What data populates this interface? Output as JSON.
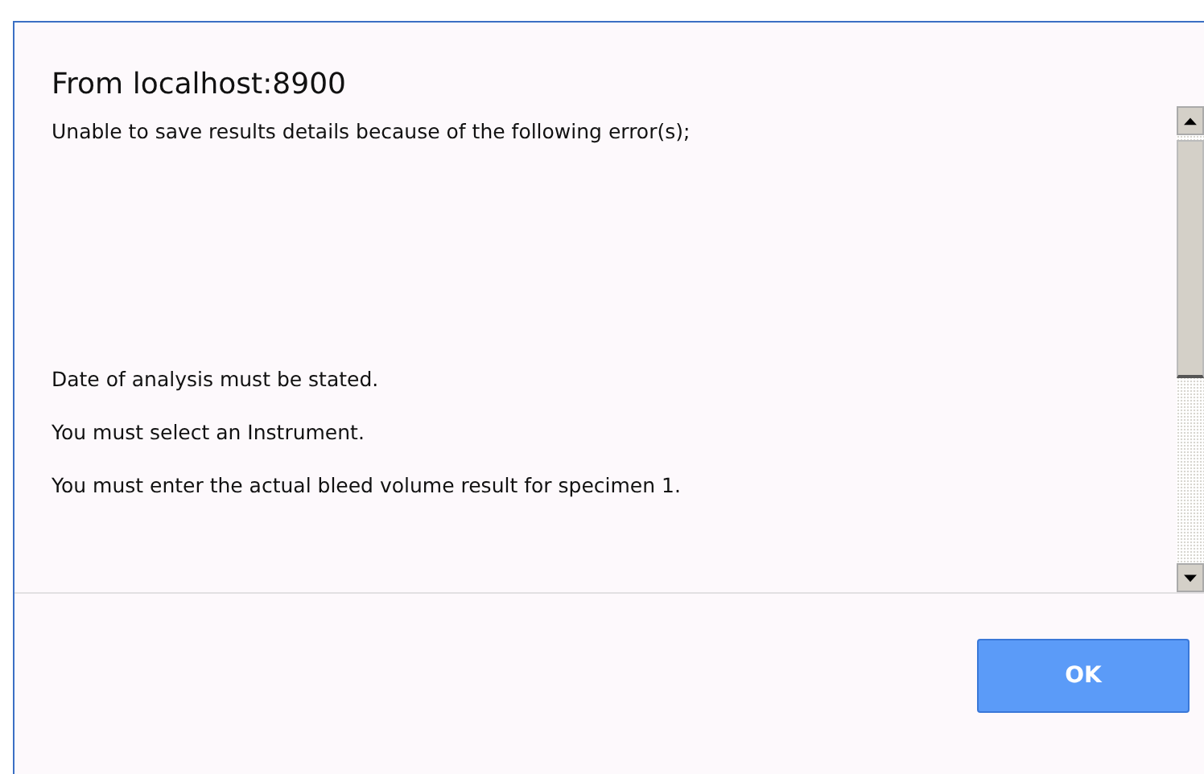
{
  "dialog": {
    "title": "From localhost:8900",
    "intro": "Unable to save results details because of the following error(s);",
    "errors": [
      "Date of analysis must be stated.",
      "You must select an Instrument.",
      "You must enter the actual bleed volume result for specimen 1."
    ],
    "buttons": [
      "OK"
    ]
  }
}
